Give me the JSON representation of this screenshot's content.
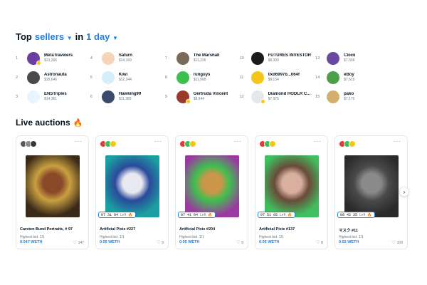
{
  "top_sellers": {
    "title_prefix": "Top",
    "title_sellers": "sellers",
    "title_in": "in",
    "title_period": "1 day",
    "sellers": [
      {
        "rank": "1",
        "name": "MetaTravelers",
        "volume": "$23,266",
        "verified": true,
        "avatar_color": "#6b3fa0"
      },
      {
        "rank": "2",
        "name": "Astronauta",
        "volume": "$18,646",
        "verified": false,
        "avatar_color": "#4a4a4a"
      },
      {
        "rank": "3",
        "name": "ENSTriples",
        "volume": "$14,361",
        "verified": false,
        "avatar_color": "#e8f4ff"
      },
      {
        "rank": "4",
        "name": "Saturn",
        "volume": "$14,169",
        "verified": false,
        "avatar_color": "#f5d5b8"
      },
      {
        "rank": "5",
        "name": "Kiwi",
        "volume": "$12,344",
        "verified": false,
        "avatar_color": "#d6eefc"
      },
      {
        "rank": "6",
        "name": "Hawking99",
        "volume": "$11,383",
        "verified": false,
        "avatar_color": "#3a4a6b"
      },
      {
        "rank": "7",
        "name": "The Marshall",
        "volume": "$11,226",
        "verified": false,
        "avatar_color": "#7a6a5a"
      },
      {
        "rank": "8",
        "name": "runguys",
        "volume": "$11,068",
        "verified": false,
        "avatar_color": "#3fbf4f"
      },
      {
        "rank": "9",
        "name": "Gertruda Vincent",
        "volume": "$8,644",
        "verified": true,
        "avatar_color": "#9a3a2a"
      },
      {
        "rank": "10",
        "name": "FUTURES INVESTOR",
        "volume": "$8,300",
        "verified": false,
        "avatar_color": "#1a1a1a"
      },
      {
        "rank": "11",
        "name": "0xd6997b...064f",
        "volume": "$8,134",
        "verified": false,
        "avatar_color": "#f5c518"
      },
      {
        "rank": "12",
        "name": "Diamond HODLR C...",
        "volume": "$7,975",
        "verified": true,
        "avatar_color": "#e5e8eb"
      },
      {
        "rank": "13",
        "name": "Clock",
        "volume": "$7,556",
        "verified": false,
        "avatar_color": "#6a4aa0"
      },
      {
        "rank": "14",
        "name": "eBoy",
        "volume": "$7,619",
        "verified": false,
        "avatar_color": "#4aa04a"
      },
      {
        "rank": "15",
        "name": "pako",
        "volume": "$7,170",
        "verified": false,
        "avatar_color": "#d4b070"
      }
    ]
  },
  "live_auctions": {
    "title": "Live auctions",
    "cards": [
      {
        "title": "Carsten Bund Portraits, # 97",
        "highest_bid_label": "Highest bid",
        "highest_bid_qty": "1/1",
        "price": "0.047 WETH",
        "likes": "147",
        "timer": "",
        "art_colors": [
          "#3a2a1a",
          "#8a4a2a",
          "#c9a040"
        ],
        "owner_colors": [
          "#5a5a5a",
          "#8a8a8a",
          "#3a3a3a"
        ]
      },
      {
        "title": "Artificial Pixie #227",
        "highest_bid_label": "Highest bid",
        "highest_bid_qty": "1/1",
        "price": "0.05 WETH",
        "likes": "9",
        "timer": "07 31 04",
        "timer_left": "Left",
        "art_colors": [
          "#1aa0a0",
          "#e8e8f0",
          "#2a4a9a"
        ],
        "owner_colors": [
          "#e53935",
          "#3fbf4f",
          "#f5c518"
        ]
      },
      {
        "title": "Artificial Pixie #204",
        "highest_bid_label": "Highest bid",
        "highest_bid_qty": "1/1",
        "price": "0.05 WETH",
        "likes": "9",
        "timer": "07 41 04",
        "timer_left": "Left",
        "art_colors": [
          "#9a3aa0",
          "#c9964a",
          "#3fbf4f"
        ],
        "owner_colors": [
          "#e53935",
          "#3fbf4f",
          "#f5c518"
        ]
      },
      {
        "title": "Artificial Pixie #137",
        "highest_bid_label": "Highest bid",
        "highest_bid_qty": "1/1",
        "price": "0.05 WETH",
        "likes": "8",
        "timer": "07 51 05",
        "timer_left": "Left",
        "art_colors": [
          "#3fbf5f",
          "#d9b0a0",
          "#6a4a3a"
        ],
        "owner_colors": [
          "#e53935",
          "#3fbf4f",
          "#f5c518"
        ]
      },
      {
        "title": "マスク #11",
        "highest_bid_label": "Highest bid",
        "highest_bid_qty": "1/1",
        "price": "0.02 WETH",
        "likes": "109",
        "timer": "08 42 35",
        "timer_left": "Left",
        "art_colors": [
          "#2a2a2a",
          "#8a8a8a",
          "#4a4a4a"
        ],
        "owner_colors": [
          "#e53935",
          "#3fbf4f",
          "#f5c518"
        ]
      }
    ]
  },
  "colors": {
    "accent": "#2081e2",
    "text": "#04111d",
    "muted": "#707a83",
    "verified_badge": "#f5c518"
  },
  "icons": {
    "period_chevron": "chevron-down-icon",
    "sellers_chevron": "chevron-down-icon",
    "fire": "fire-icon",
    "more": "more-dots-icon",
    "heart": "heart-icon",
    "next": "chevron-right-icon"
  }
}
